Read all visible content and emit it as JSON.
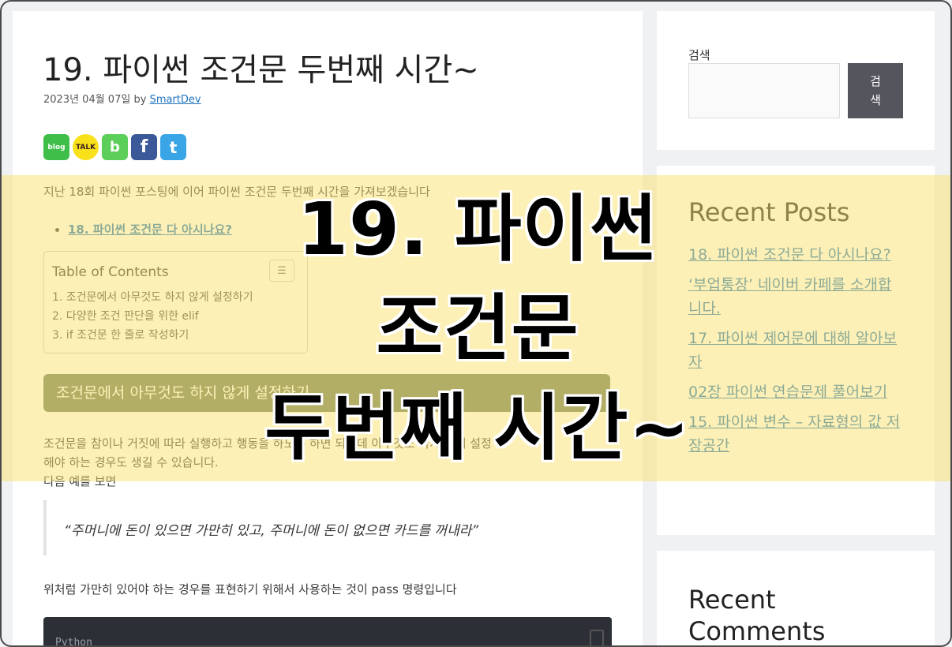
{
  "post": {
    "title": "19. 파이썬 조건문 두번째 시간~",
    "date": "2023년 04월 07일",
    "by": "by",
    "author": "SmartDev",
    "share_icons": [
      {
        "name": "blog",
        "label": "blog",
        "color": "#3fbf4a"
      },
      {
        "name": "kakaotalk",
        "label": "TALK",
        "color": "#f8e01a"
      },
      {
        "name": "band",
        "label": "b",
        "color": "#5ccf5a"
      },
      {
        "name": "facebook",
        "label": "f",
        "color": "#3b5998"
      },
      {
        "name": "twitter",
        "label": "t",
        "color": "#3aa5e6"
      }
    ],
    "intro": "지난 18회 파이썬 포스팅에 이어 파이썬 조건문 두번째 시간을 가져보겠습니다",
    "prev_link": "18. 파이썬 조건문 다 아시나요?",
    "toc": {
      "title": "Table of Contents",
      "items": [
        "1. 조건문에서 아무것도 하지 않게 설정하기",
        "2. 다양한 조건 판단을 위한 elif",
        "3. if 조건문 한 줄로 작성하기"
      ]
    },
    "section_heading": "조건문에서 아무것도 하지 않게 설정하기",
    "para_line1": "조건문을 참이나 거짓에 따라 실행하고 행동을 하도록 하면 되는데 아무것도 하지 않게 설정",
    "para_line2": "해야 하는 경우도 생길 수 있습니다.",
    "para_line3": "다음 예를 보면",
    "quote": "“주머니에 돈이 있으면 가만히 있고, 주머니에 돈이 없으면 카드를 꺼내라”",
    "para_pass": "위처럼 가만히 있어야 하는 경우를 표현하기 위해서 사용하는 것이 pass 명령입니다",
    "code_lang": "Python"
  },
  "sidebar": {
    "search_label": "검색",
    "search_button": "검색",
    "recent_posts_title": "Recent Posts",
    "recent_posts": [
      "18. 파이썬 조건문 다 아시나요?",
      "‘부업통장’ 네이버 카페를 소개합니다.",
      "17. 파이썬 제어문에 대해 알아보자",
      "02장 파이썬 연습문제 풀어보기",
      "15. 파이썬 변수 – 자료형의 값 저장공간"
    ],
    "recent_comments_title": "Recent Comments"
  },
  "overlay": {
    "line1": "19. 파이썬",
    "line2": "조건문",
    "line3": "두번째 시간~",
    "band_color": "#fae26e"
  }
}
